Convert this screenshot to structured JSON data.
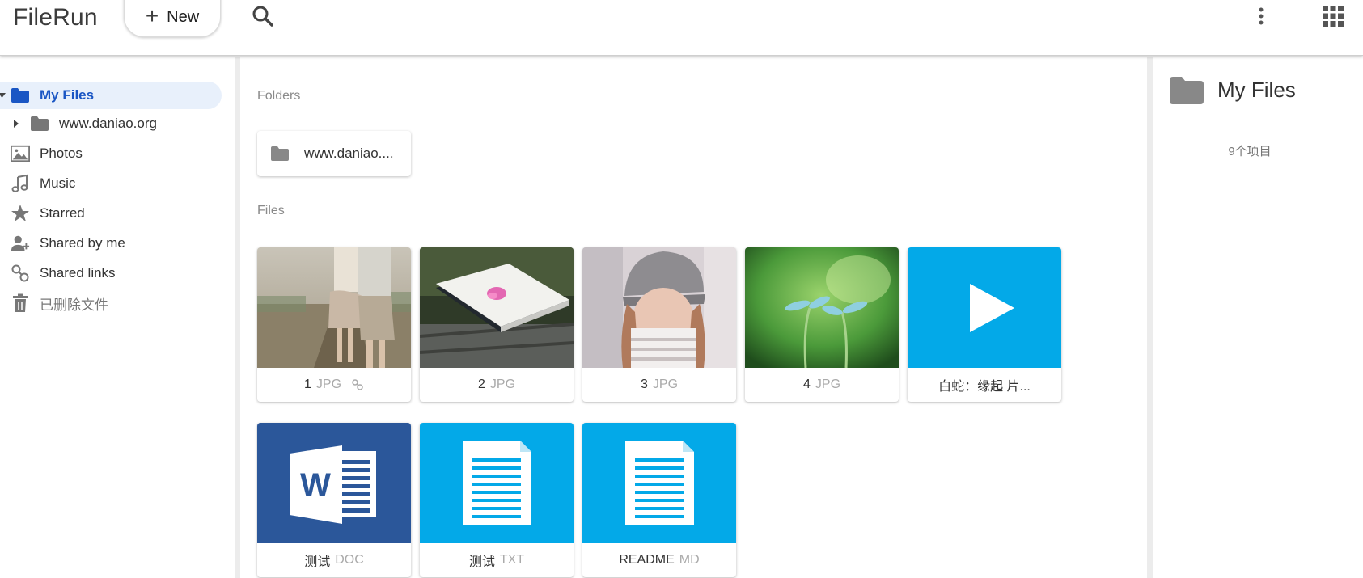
{
  "header": {
    "app_title": "FileRun",
    "new_label": "New",
    "icons": {
      "search": "search-icon",
      "more": "more-vert-icon",
      "apps": "apps-grid-icon"
    }
  },
  "sidebar": {
    "items": [
      {
        "label": "My Files",
        "icon": "folder-icon",
        "active": true
      },
      {
        "label": "www.daniao.org",
        "icon": "folder-icon"
      },
      {
        "label": "Photos",
        "icon": "photo-icon"
      },
      {
        "label": "Music",
        "icon": "music-note-icon"
      },
      {
        "label": "Starred",
        "icon": "star-icon"
      },
      {
        "label": "Shared by me",
        "icon": "person-add-icon"
      },
      {
        "label": "Shared links",
        "icon": "link-icon"
      },
      {
        "label": "已删除文件",
        "icon": "trash-icon"
      }
    ]
  },
  "main": {
    "folders_label": "Folders",
    "files_label": "Files",
    "folders": [
      {
        "name": "www.daniao...."
      }
    ],
    "files": [
      {
        "name": "1",
        "ext": "JPG",
        "thumb": "photo-couple",
        "shared_link": true
      },
      {
        "name": "2",
        "ext": "JPG",
        "thumb": "photo-book"
      },
      {
        "name": "3",
        "ext": "JPG",
        "thumb": "photo-girl"
      },
      {
        "name": "4",
        "ext": "JPG",
        "thumb": "photo-sprout"
      },
      {
        "name": "白蛇：缘起 片...",
        "ext": "",
        "thumb": "video-play"
      },
      {
        "name": "测试",
        "ext": "DOC",
        "thumb": "word-doc"
      },
      {
        "name": "测试",
        "ext": "TXT",
        "thumb": "text-doc"
      },
      {
        "name": "README",
        "ext": "MD",
        "thumb": "text-doc"
      }
    ]
  },
  "details": {
    "title": "My Files",
    "count": "9个项目"
  },
  "colors": {
    "accent": "#1a56c4",
    "video_bg": "#03a9e8",
    "word_bg": "#2b579a",
    "doc_bg": "#03a9e8",
    "active_bg": "#e8f0fb"
  }
}
